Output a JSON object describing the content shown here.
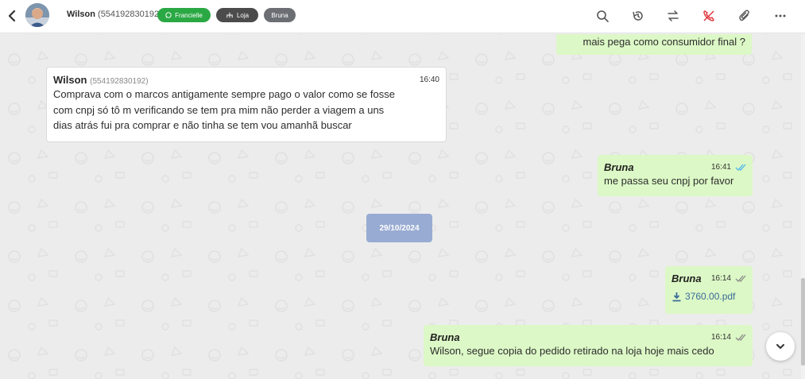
{
  "header": {
    "contact_name": "Wilson",
    "contact_number": "(554192830192)",
    "tags": [
      {
        "label": "Francielle",
        "icon": "whatsapp-icon",
        "color": "#2aa844"
      },
      {
        "label": "Loja",
        "icon": "sitemap-icon",
        "color": "#4b4b4b"
      },
      {
        "label": "Bruna",
        "color": "#6b6f74"
      }
    ],
    "actions": [
      "search-icon",
      "history-icon",
      "transfer-icon",
      "hangup-icon",
      "attach-icon",
      "more-icon"
    ]
  },
  "messages": [
    {
      "direction": "out",
      "text": "mais pega como consumidor final ?"
    },
    {
      "direction": "in",
      "sender": "Wilson",
      "number": "(554192830192)",
      "time": "16:40",
      "lines": [
        "Comprava com o marcos antigamente sempre pago o valor como se fosse",
        "com cnpj só tô m verificando se tem pra mim não perder a viagem a uns",
        "dias atrás fui pra comprar e não tinha se tem vou amanhã buscar"
      ]
    },
    {
      "direction": "out",
      "sender": "Bruna",
      "time": "16:41",
      "status": "read",
      "text": "me passa seu cnpj por favor"
    },
    {
      "direction": "out",
      "sender": "Bruna",
      "time": "16:14",
      "status": "delivered",
      "attachment": "3760.00.pdf"
    },
    {
      "direction": "out",
      "sender": "Bruna",
      "time": "16:14",
      "status": "delivered",
      "text": "Wilson, segue copia do pedido retirado na loja hoje mais cedo"
    }
  ],
  "date_separator": "29/10/2024",
  "colors": {
    "outgoing_bubble": "#dcf8c6",
    "incoming_bubble": "#ffffff",
    "date_chip": "#98abd2",
    "read_tick": "#4fb6ec",
    "hangup": "#e0353d"
  }
}
